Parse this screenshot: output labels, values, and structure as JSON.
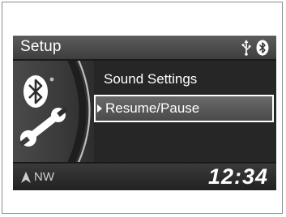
{
  "header": {
    "title": "Setup",
    "status_icons": [
      "usb-icon",
      "bluetooth-icon"
    ]
  },
  "sidebar": {
    "icon": "bluetooth-settings-icon"
  },
  "menu": {
    "items": [
      {
        "label": "Sound Settings",
        "selected": false
      },
      {
        "label": "Resume/Pause",
        "selected": true
      }
    ]
  },
  "footer": {
    "compass": "NW",
    "clock": "12:34"
  },
  "colors": {
    "screen_bg": "#2a2a2a",
    "header_bg": "#4d4d4d",
    "text": "#ffffff",
    "selection_border": "#ffffff"
  }
}
